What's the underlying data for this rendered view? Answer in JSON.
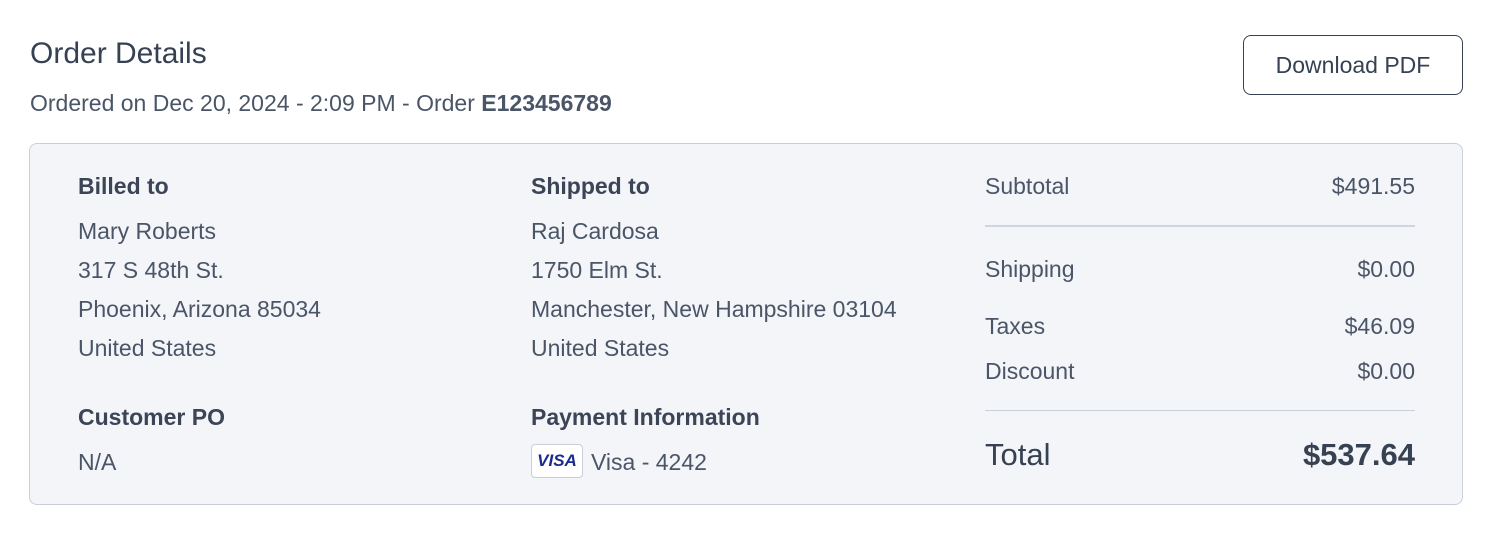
{
  "header": {
    "title": "Order Details",
    "meta_prefix": "Ordered on Dec 20, 2024 - 2:09 PM - Order ",
    "order_id": "E123456789",
    "download_label": "Download PDF"
  },
  "billed_to": {
    "label": "Billed to",
    "name": "Mary Roberts",
    "street": "317 S 48th St.",
    "city_line": "Phoenix, Arizona 85034",
    "country": "United States"
  },
  "shipped_to": {
    "label": "Shipped to",
    "name": "Raj Cardosa",
    "street": "1750 Elm St.",
    "city_line": "Manchester, New Hampshire 03104",
    "country": "United States"
  },
  "customer_po": {
    "label": "Customer PO",
    "value": "N/A"
  },
  "payment": {
    "label": "Payment Information",
    "card_brand_logo": "VISA",
    "card_text": "Visa - 4242"
  },
  "summary": {
    "subtotal_label": "Subtotal",
    "subtotal_value": "$491.55",
    "shipping_label": "Shipping",
    "shipping_value": "$0.00",
    "taxes_label": "Taxes",
    "taxes_value": "$46.09",
    "discount_label": "Discount",
    "discount_value": "$0.00",
    "total_label": "Total",
    "total_value": "$537.64"
  },
  "colors": {
    "card_background": "#f3f5f9",
    "card_border": "#c8cfd9",
    "text_primary": "#364152",
    "visa_blue": "#1a2a8f"
  }
}
